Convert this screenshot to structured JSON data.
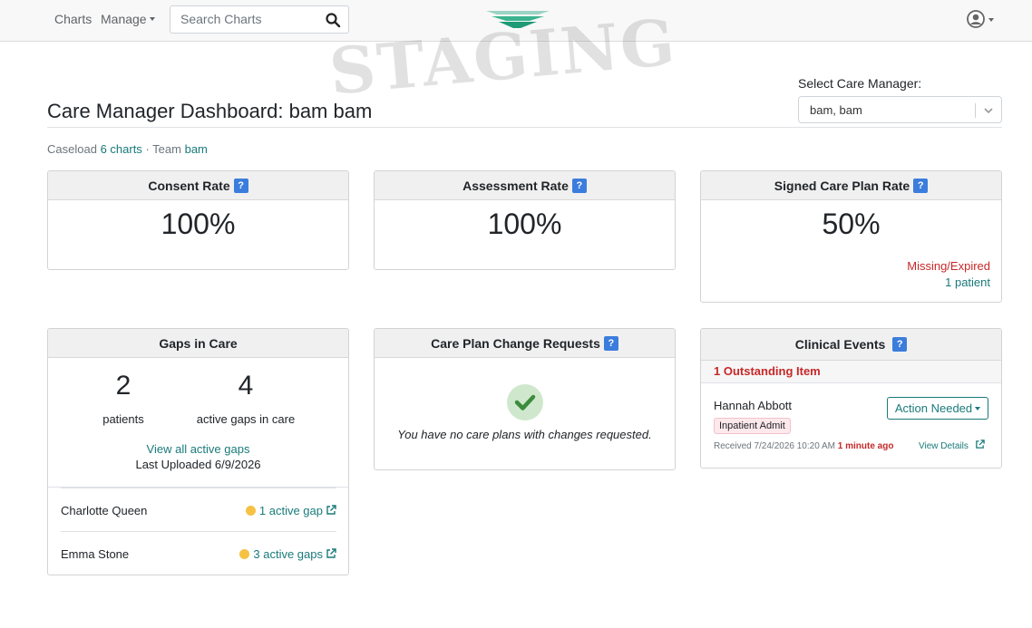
{
  "nav": {
    "charts": "Charts",
    "manage": "Manage",
    "search_placeholder": "Search Charts"
  },
  "watermark": "STAGING",
  "header": {
    "title": "Care Manager Dashboard: bam bam",
    "care_manager_label": "Select Care Manager:",
    "care_manager_value": "bam, bam"
  },
  "caseload": {
    "prefix": "Caseload",
    "charts_link": "6 charts",
    "separator": "·",
    "team_prefix": "Team",
    "team_link": "bam"
  },
  "cards": {
    "consent": {
      "title": "Consent Rate",
      "help": "?",
      "value": "100%"
    },
    "assessment": {
      "title": "Assessment Rate",
      "help": "?",
      "value": "100%"
    },
    "signed_care_plan": {
      "title": "Signed Care Plan Rate",
      "help": "?",
      "value": "50%",
      "missing_label": "Missing/Expired",
      "missing_count": "1 patient"
    },
    "gaps": {
      "title": "Gaps in Care",
      "patients_value": "2",
      "patients_label": "patients",
      "gaps_value": "4",
      "gaps_label": "active gaps in care",
      "view_all": "View all active gaps",
      "last_uploaded": "Last Uploaded 6/9/2026",
      "rows": [
        {
          "name": "Charlotte Queen",
          "gap_text": "1 active gap"
        },
        {
          "name": "Emma Stone",
          "gap_text": "3 active gaps"
        }
      ]
    },
    "change_requests": {
      "title": "Care Plan Change Requests",
      "help": "?",
      "empty_text": "You have no care plans with changes requested."
    },
    "clinical_events": {
      "title": "Clinical Events",
      "help": "?",
      "outstanding": "1 Outstanding Item",
      "event": {
        "patient": "Hannah Abbott",
        "badge": "Inpatient Admit",
        "action_label": "Action Needed",
        "received": "Received 7/24/2026 10:20 AM",
        "ago": "1 minute ago",
        "view_details": "View Details"
      }
    }
  },
  "colors": {
    "accent": "#1a7a7a",
    "help_badge": "#3b7ddd",
    "alert_red": "#c62828",
    "gap_dot": "#f6c244",
    "success_check": "#3d8b3d"
  },
  "icons": {
    "search": "search-icon",
    "logo": "brand-logo",
    "user": "user-circle-icon",
    "external": "external-link-icon",
    "check": "check-icon",
    "chevron": "chevron-down-icon"
  }
}
